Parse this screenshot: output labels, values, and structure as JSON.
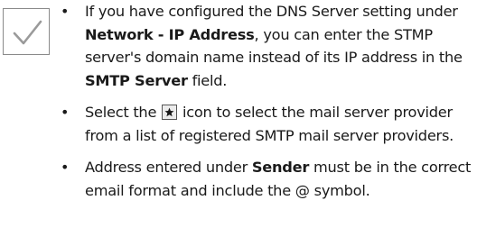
{
  "icons": {
    "checkmark": "check-icon",
    "provider": "star-icon",
    "bullet": "•"
  },
  "colors": {
    "text": "#1a1a1a",
    "checkmark": "#9a9a9a",
    "box_border": "#8a8a8a"
  },
  "notes": [
    {
      "t1": "If you have configured the DNS Server setting under ",
      "b1": "Network - IP Address",
      "t2": ", you can enter the STMP server's domain name instead of its IP address in the ",
      "b2": "SMTP Server",
      "t3": " field."
    },
    {
      "t1": "Select the ",
      "t2": " icon to select the mail server provider from a list of registered SMTP mail server providers."
    },
    {
      "t1": "Address entered under ",
      "b1": "Sender",
      "t2": " must be in the correct email format and include the @ symbol."
    }
  ]
}
